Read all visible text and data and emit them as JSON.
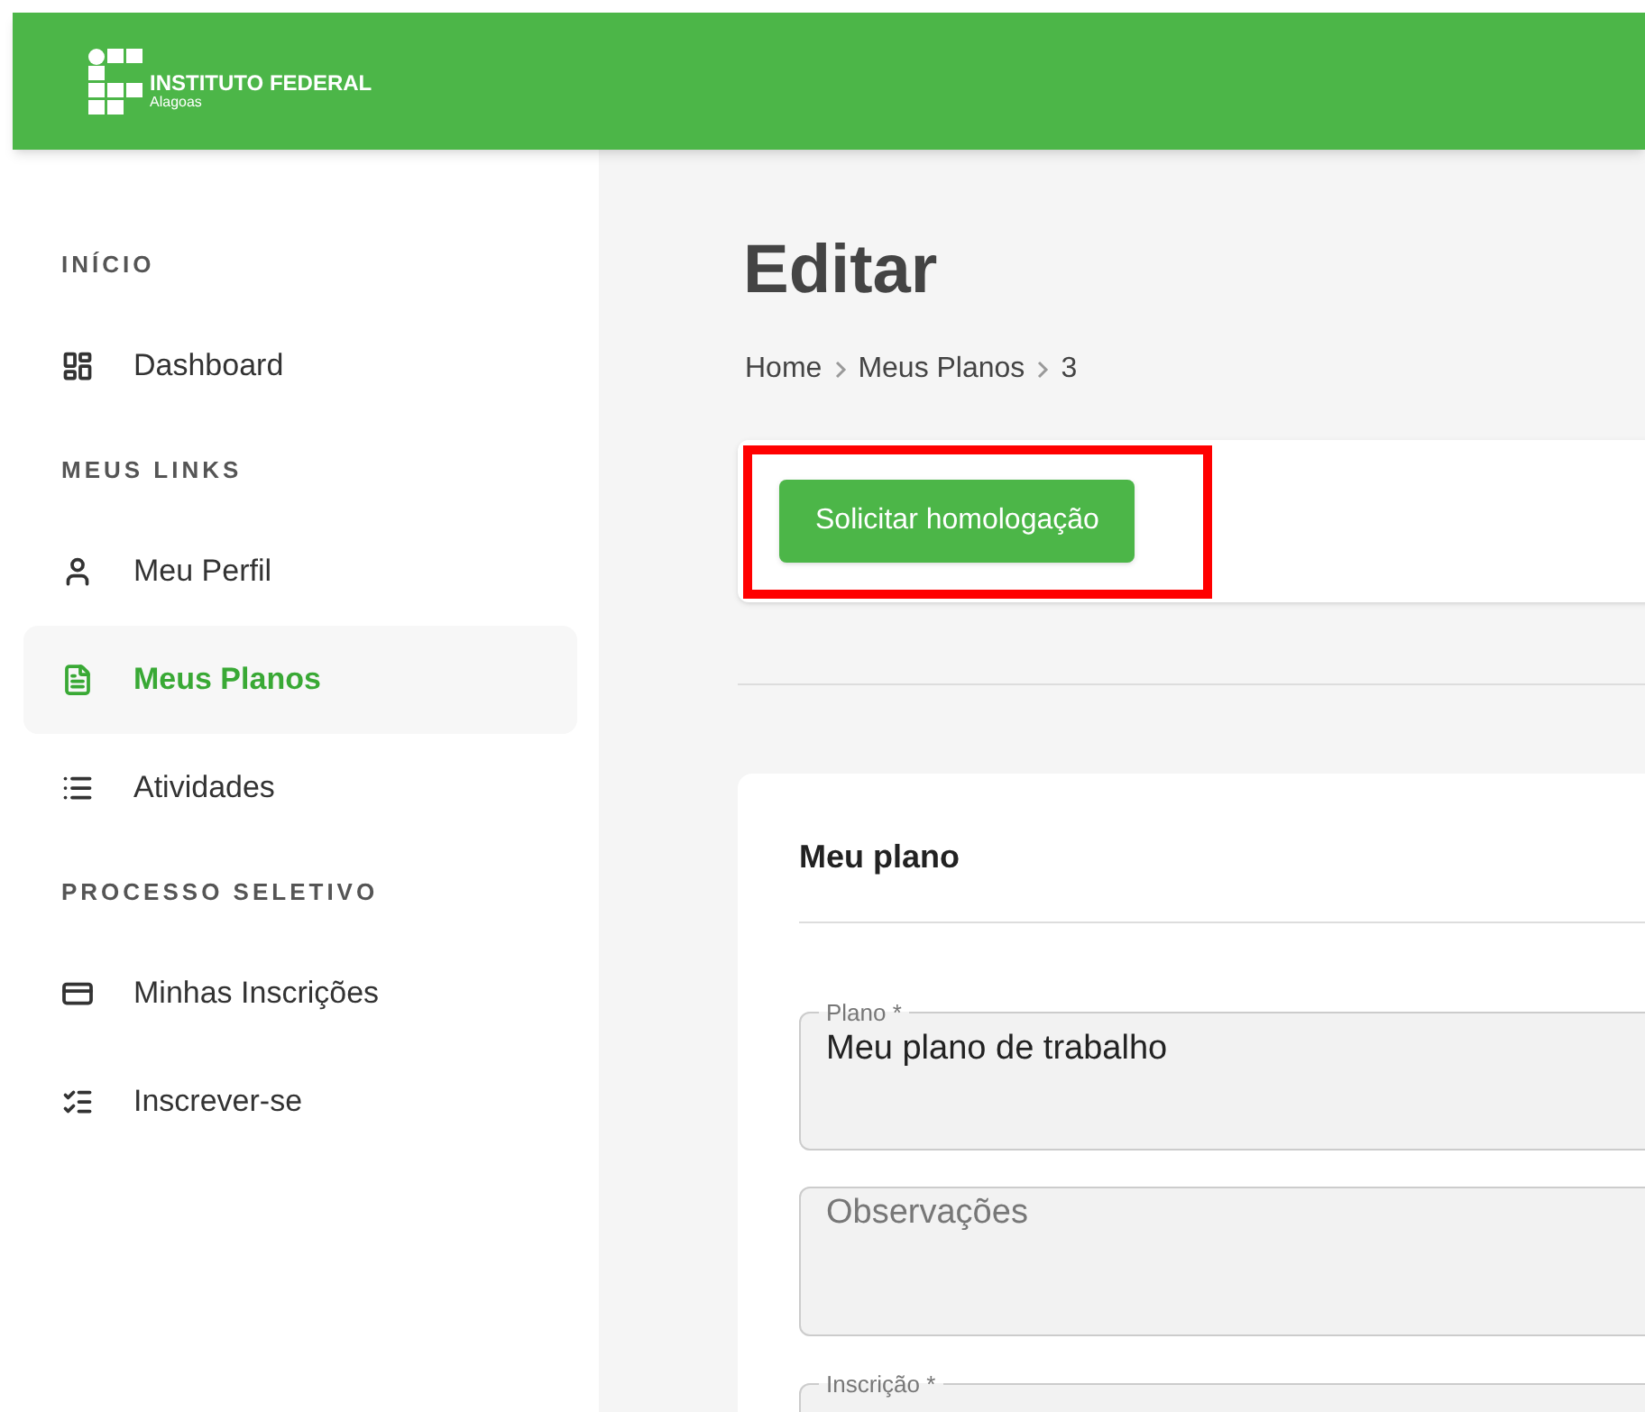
{
  "header": {
    "logo_title": "INSTITUTO FEDERAL",
    "logo_subtitle": "Alagoas"
  },
  "sidebar": {
    "sections": [
      {
        "title": "INÍCIO",
        "items": [
          {
            "label": "Dashboard",
            "selected": false
          }
        ]
      },
      {
        "title": "MEUS LINKS",
        "items": [
          {
            "label": "Meu Perfil",
            "selected": false
          },
          {
            "label": "Meus Planos",
            "selected": true
          },
          {
            "label": "Atividades",
            "selected": false
          }
        ]
      },
      {
        "title": "PROCESSO SELETIVO",
        "items": [
          {
            "label": "Minhas Inscrições",
            "selected": false
          },
          {
            "label": "Inscrever-se",
            "selected": false
          }
        ]
      }
    ]
  },
  "page": {
    "title": "Editar",
    "breadcrumb": [
      "Home",
      "Meus Planos",
      "3"
    ],
    "action_button": "Solicitar homologação",
    "action_highlighted": true
  },
  "form": {
    "title": "Meu plano",
    "fields": [
      {
        "label": "Plano *",
        "value": "Meu plano de trabalho"
      },
      {
        "placeholder": "Observações"
      },
      {
        "label": "Inscrição *"
      }
    ]
  }
}
